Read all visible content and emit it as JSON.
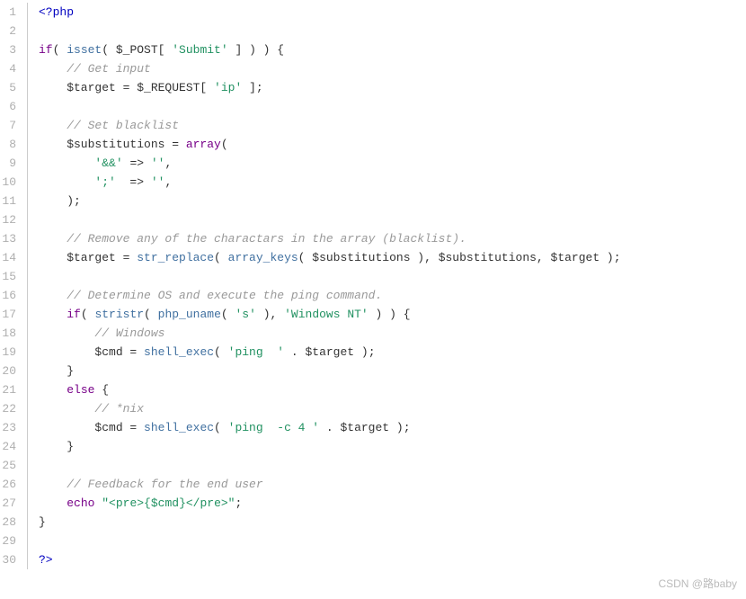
{
  "footer": "CSDN @路baby",
  "lines": [
    {
      "n": 1,
      "html": "<span class='blue'>&lt;?php</span>"
    },
    {
      "n": 2,
      "html": ""
    },
    {
      "n": 3,
      "html": "<span class='kw'>if</span>( <span class='fn'>isset</span>( $_POST[ <span class='str'>'Submit'</span> ] ) ) {"
    },
    {
      "n": 4,
      "html": "    <span class='cmt'>// Get input</span>"
    },
    {
      "n": 5,
      "html": "    $target = $_REQUEST[ <span class='str'>'ip'</span> ];"
    },
    {
      "n": 6,
      "html": ""
    },
    {
      "n": 7,
      "html": "    <span class='cmt'>// Set blacklist</span>"
    },
    {
      "n": 8,
      "html": "    $substitutions = <span class='kw'>array</span>("
    },
    {
      "n": 9,
      "html": "        <span class='str'>'&amp;&amp;'</span> =&gt; <span class='str'>''</span>,"
    },
    {
      "n": 10,
      "html": "        <span class='str'>';'</span>  =&gt; <span class='str'>''</span>,"
    },
    {
      "n": 11,
      "html": "    );"
    },
    {
      "n": 12,
      "html": ""
    },
    {
      "n": 13,
      "html": "    <span class='cmt'>// Remove any of the charactars in the array (blacklist).</span>"
    },
    {
      "n": 14,
      "html": "    $target = <span class='fn'>str_replace</span>( <span class='fn'>array_keys</span>( $substitutions ), $substitutions, $target );"
    },
    {
      "n": 15,
      "html": ""
    },
    {
      "n": 16,
      "html": "    <span class='cmt'>// Determine OS and execute the ping command.</span>"
    },
    {
      "n": 17,
      "html": "    <span class='kw'>if</span>( <span class='fn'>stristr</span>( <span class='fn'>php_uname</span>( <span class='str'>'s'</span> ), <span class='str'>'Windows NT'</span> ) ) {"
    },
    {
      "n": 18,
      "html": "        <span class='cmt'>// Windows</span>"
    },
    {
      "n": 19,
      "html": "        $cmd = <span class='fn'>shell_exec</span>( <span class='str'>'ping  '</span> . $target );"
    },
    {
      "n": 20,
      "html": "    }"
    },
    {
      "n": 21,
      "html": "    <span class='kw'>else</span> {"
    },
    {
      "n": 22,
      "html": "        <span class='cmt'>// *nix</span>"
    },
    {
      "n": 23,
      "html": "        $cmd = <span class='fn'>shell_exec</span>( <span class='str'>'ping  -c 4 '</span> . $target );"
    },
    {
      "n": 24,
      "html": "    }"
    },
    {
      "n": 25,
      "html": ""
    },
    {
      "n": 26,
      "html": "    <span class='cmt'>// Feedback for the end user</span>"
    },
    {
      "n": 27,
      "html": "    <span class='kw'>echo</span> <span class='str'>\"&lt;pre&gt;{$cmd}&lt;/pre&gt;\"</span>;"
    },
    {
      "n": 28,
      "html": "}"
    },
    {
      "n": 29,
      "html": ""
    },
    {
      "n": 30,
      "html": "<span class='blue'>?&gt;</span>"
    }
  ]
}
